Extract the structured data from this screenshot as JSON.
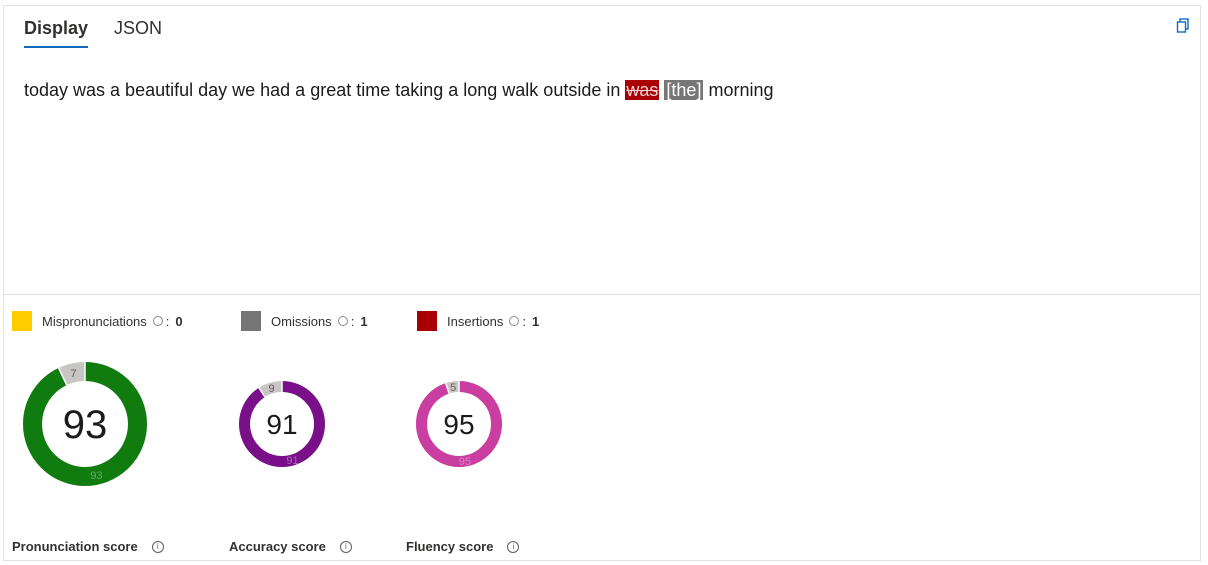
{
  "tabs": [
    {
      "label": "Display",
      "active": true
    },
    {
      "label": "JSON",
      "active": false
    }
  ],
  "transcript": {
    "text_before": "today was a beautiful day we had a great time taking a long walk outside in",
    "insertion_word": "was",
    "omission_word": "[the]",
    "text_after": "morning"
  },
  "legend": [
    {
      "label": "Mispronunciations",
      "sep": ":",
      "count": "0",
      "color": "#ffcc00"
    },
    {
      "label": "Omissions",
      "sep": ":",
      "count": "1",
      "color": "#767676"
    },
    {
      "label": "Insertions",
      "sep": ":",
      "count": "1",
      "color": "#a80000"
    }
  ],
  "scores": [
    {
      "label": "Pronunciation score",
      "score": 93,
      "score_text": "93",
      "remainder_text": "7",
      "color": "#107c10"
    },
    {
      "label": "Accuracy score",
      "score": 91,
      "score_text": "91",
      "remainder_text": "9",
      "color": "#7a0f8a"
    },
    {
      "label": "Fluency score",
      "score": 95,
      "score_text": "95",
      "remainder_text": "5",
      "color": "#c93ea0"
    }
  ],
  "icons": {
    "copy": "copy-icon",
    "info": "info-icon"
  },
  "colors": {
    "accent": "#0f6cbd",
    "remainder": "#c8c6c4"
  }
}
